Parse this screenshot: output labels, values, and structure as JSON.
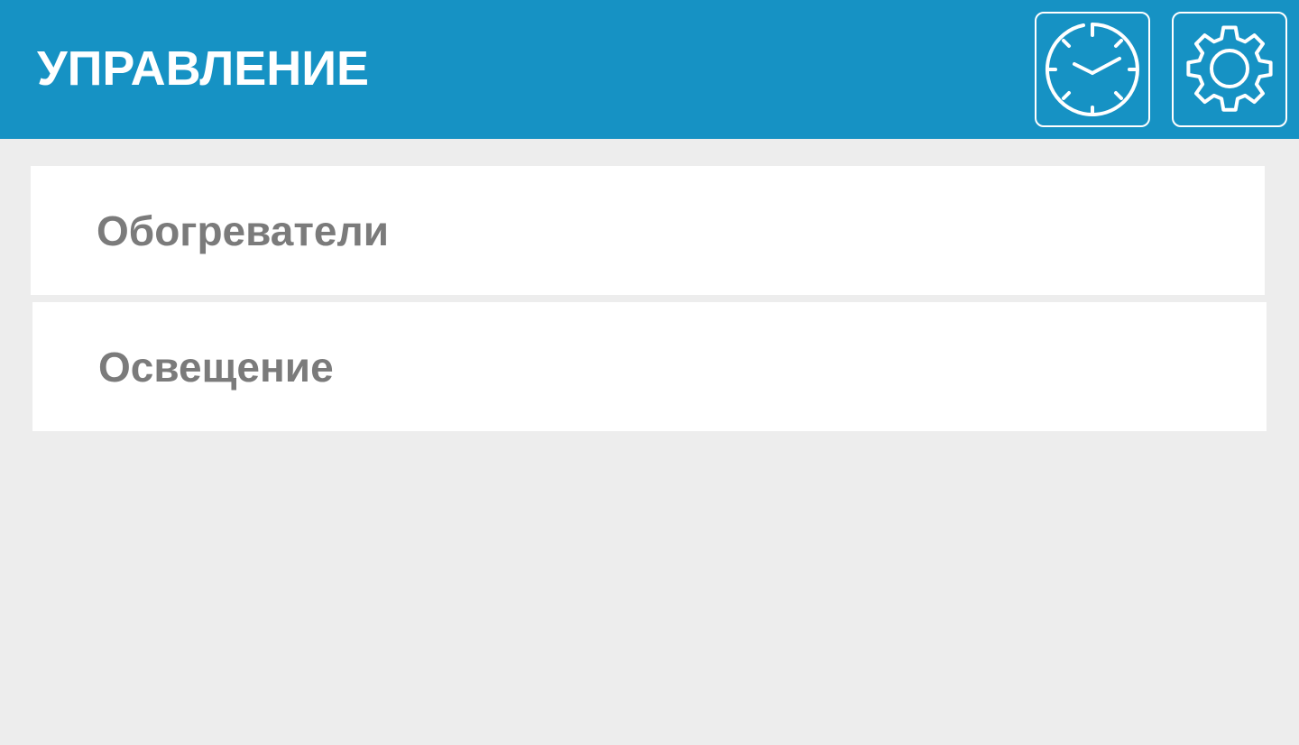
{
  "header": {
    "title": "УПРАВЛЕНИЕ",
    "background_color": "#1692c4",
    "buttons": [
      {
        "icon": "clock-icon"
      },
      {
        "icon": "gear-icon"
      }
    ]
  },
  "menu": {
    "items": [
      {
        "label": "Обогреватели"
      },
      {
        "label": "Освещение"
      }
    ]
  },
  "colors": {
    "page_background": "#ededed",
    "item_background": "#ffffff",
    "item_text": "#7b7b7b",
    "header_text": "#ffffff"
  }
}
